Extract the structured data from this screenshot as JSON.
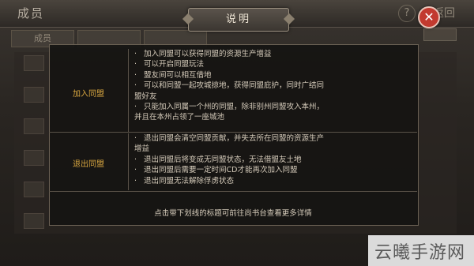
{
  "background": {
    "title": "成员",
    "help": "?",
    "back": "返回",
    "tabs": [
      "成员",
      "",
      ""
    ]
  },
  "dialog": {
    "title": "说明",
    "close_symbol": "✕",
    "sections": [
      {
        "label": "加入同盟",
        "items": [
          [
            "加入同盟可以获得同盟的资源生产增益"
          ],
          [
            "可以开启同盟玩法"
          ],
          [
            "盟友间可以相互借地"
          ],
          [
            "可以和同盟一起攻城掠地，获得同盟庇护，同时广结同",
            "盟好友"
          ],
          [
            "只能加入同属一个州的同盟，除非别州同盟攻入本州，",
            "并且在本州占领了一座城池"
          ]
        ]
      },
      {
        "label": "退出同盟",
        "items": [
          [
            "退出同盟会清空同盟贡献，并失去所在同盟的资源生产",
            "增益"
          ],
          [
            "退出同盟后将变成无同盟状态，无法借盟友土地"
          ],
          [
            "退出同盟后需要一定时间CD才能再次加入同盟"
          ],
          [
            "退出同盟无法解除俘虏状态"
          ]
        ]
      }
    ],
    "footer": "点击带下划线的标题可前往尚书台查看更多详情"
  },
  "watermark": "云曦手游网",
  "colors": {
    "accent": "#d8a640",
    "text": "#d6ccbb",
    "close": "#c23a2f"
  }
}
